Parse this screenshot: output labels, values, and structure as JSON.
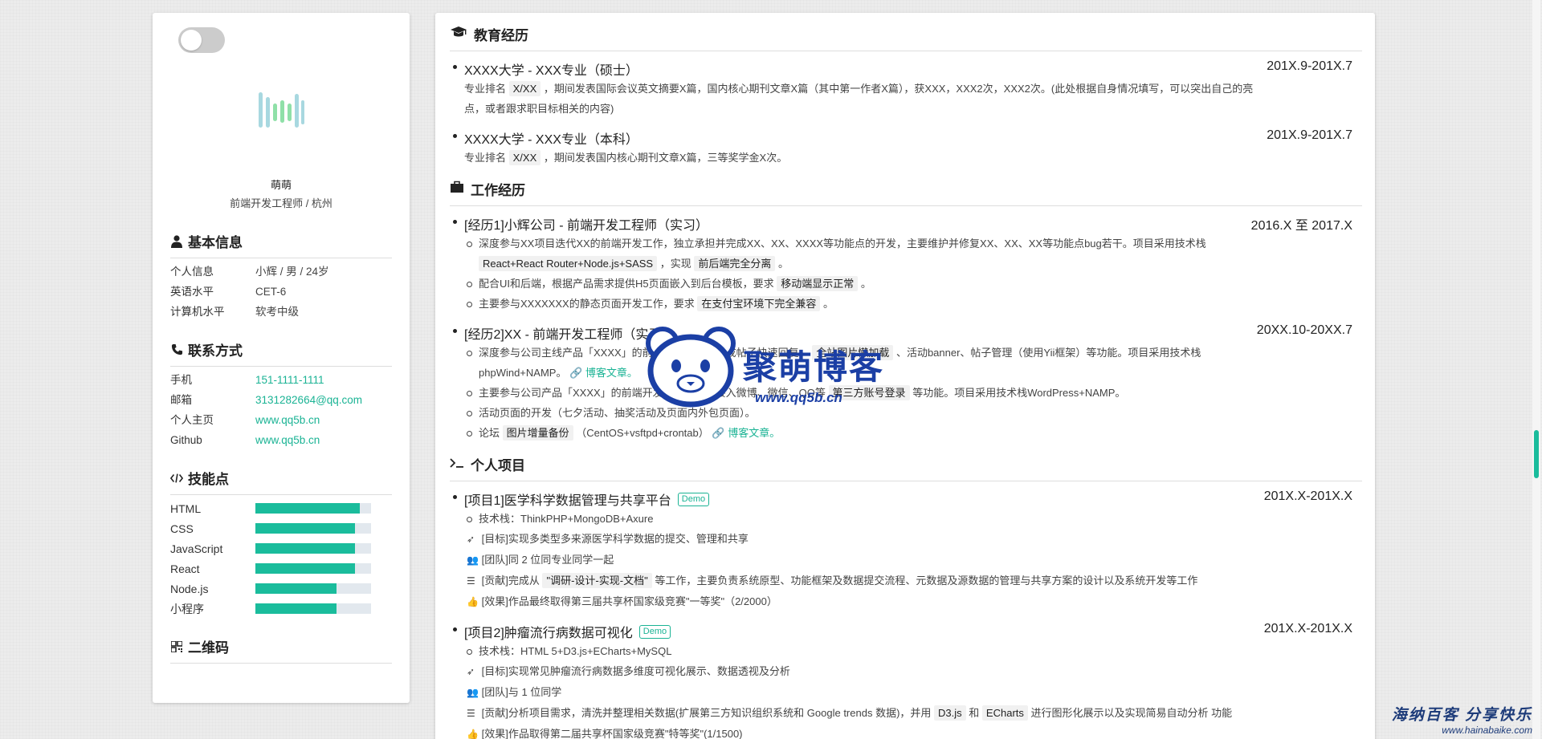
{
  "sidebar": {
    "name": "萌萌",
    "role": "前端开发工程师 / 杭州",
    "basic": {
      "title": "基本信息",
      "rows": [
        {
          "k": "个人信息",
          "v": "小辉 / 男 / 24岁"
        },
        {
          "k": "英语水平",
          "v": "CET-6"
        },
        {
          "k": "计算机水平",
          "v": "软考中级"
        }
      ]
    },
    "contact": {
      "title": "联系方式",
      "rows": [
        {
          "k": "手机",
          "v": "151-1111-1111"
        },
        {
          "k": "邮箱",
          "v": "3131282664@qq.com"
        },
        {
          "k": "个人主页",
          "v": "www.qq5b.cn"
        },
        {
          "k": "Github",
          "v": "www.qq5b.cn"
        }
      ]
    },
    "skills": {
      "title": "技能点",
      "items": [
        {
          "k": "HTML",
          "level": 0.9
        },
        {
          "k": "CSS",
          "level": 0.86
        },
        {
          "k": "JavaScript",
          "level": 0.86
        },
        {
          "k": "React",
          "level": 0.86
        },
        {
          "k": "Node.js",
          "level": 0.7
        },
        {
          "k": "小程序",
          "level": 0.7
        }
      ]
    },
    "qr": {
      "title": "二维码"
    }
  },
  "education": {
    "title": "教育经历",
    "items": [
      {
        "school": "XXXX大学 - XXX专业（硕士）",
        "date": "201X.9-201X.7",
        "d1": "专业排名",
        "code": "X/XX",
        "d2": "，期间发表国际会议英文摘要X篇，国内核心期刊文章X篇（其中第一作者X篇），获XXX，XXX2次，XXX2次。(此处根据自身情况填写，可以突出自己的亮",
        "d3": "点，或者跟求职目标相关的内容)"
      },
      {
        "school": "XXXX大学 - XXX专业（本科）",
        "date": "201X.9-201X.7",
        "d1": "专业排名",
        "code": "X/XX",
        "d2": "，期间发表国内核心期刊文章X篇，三等奖学金X次。"
      }
    ]
  },
  "work": {
    "title": "工作经历",
    "items": [
      {
        "title": "[经历1]小辉公司 - 前端开发工程师（实习）",
        "date": "2016.X 至 2017.X",
        "l1a": "深度参与XX项目迭代XX的前端开发工作，独立承担并完成XX、XX、XXXX等功能点的开发，主要维护并修复XX、XX、XX等功能点bug若干。项目采用技术栈",
        "l1b": "React+React Router+Node.js+SASS",
        "l1c": "，实现",
        "l1d": "前后端完全分离",
        "l1e": "。",
        "l2a": "配合UI和后端，根据产品需求提供H5页面嵌入到后台模板，要求",
        "l2b": "移动端显示正常",
        "l2c": "。",
        "l3a": "主要参与XXXXXXX的静态页面开发工作，要求",
        "l3b": "在支付宝环境下完全兼容",
        "l3c": "。"
      },
      {
        "title": "[经历2]XX - 前端开发工程师（实习）",
        "date": "20XX.10-20XX.7",
        "l1a": "深度参与公司主线产品「XXXX」的前端开发工作，完成帖子快速回复、",
        "l1b": "全站图片懒加载",
        "l1c": "、活动banner、帖子管理（使用Yii框架）等功能。项目采用技术栈",
        "l1d": "phpWind+NAMP。",
        "l1e": "博客文章。",
        "l2a": "主要参与公司产品「XXXX」的前端开发工作，实现接入微博、微信、QQ等",
        "l2b": "第三方账号登录",
        "l2c": "等功能。项目采用技术栈WordPress+NAMP。",
        "l3a": "活动页面的开发（七夕活动、抽奖活动及页面内外包页面）。",
        "l4a": "论坛",
        "l4b": "图片增量备份",
        "l4c": "（CentOS+vsftpd+crontab）",
        "l4d": "博客文章。"
      }
    ]
  },
  "projects": {
    "title": "个人项目",
    "demo": "Demo",
    "items": [
      {
        "title": "[项目1]医学科学数据管理与共享平台",
        "date": "201X.X-201X.X",
        "tech": "技术栈：ThinkPHP+MongoDB+Axure",
        "goal": "[目标]实现多类型多来源医学科学数据的提交、管理和共享",
        "team": "[团队]同 2 位同专业同学一起",
        "c1": "[贡献]完成从",
        "c2": "\"调研-设计-实现-文档\"",
        "c3": "等工作，主要负责系统原型、功能框架及数据提交流程、元数据及源数据的管理与共享方案的设计以及系统开发等工作",
        "effect": "[效果]作品最终取得第三届共享杯国家级竞赛\"一等奖\"（2/2000）"
      },
      {
        "title": "[项目2]肿瘤流行病数据可视化",
        "date": "201X.X-201X.X",
        "tech": "技术栈：HTML 5+D3.js+ECharts+MySQL",
        "goal": "[目标]实现常见肿瘤流行病数据多维度可视化展示、数据透视及分析",
        "team": "[团队]与 1 位同学",
        "c1": "[贡献]分析项目需求，清洗并整理相关数据(扩展第三方知识组织系统和 Google trends 数据)，并用",
        "c2": "D3.js",
        "c3": "和",
        "c4": "ECharts",
        "c5": "进行图形化展示以及实现简易自动分析 功能",
        "effect": "[效果]作品取得第二届共享杯国家级竞赛\"特等奖\"(1/1500)"
      }
    ]
  },
  "watermark": {
    "text": "聚萌博客",
    "url": "www.qq5b.cn",
    "corner": "海纳百客 分享快乐",
    "corner_url": "www.hainabaike.com"
  },
  "colors": {
    "accent": "#1abc9c",
    "link": "#1ab394",
    "watermark": "#1b3fa5"
  }
}
